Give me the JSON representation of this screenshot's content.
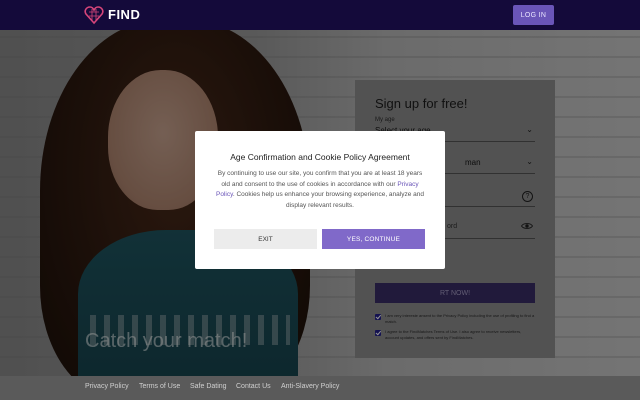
{
  "header": {
    "logo_text": "FIND",
    "logo_sub": "",
    "login_label": "LOG IN"
  },
  "hero": {
    "tagline": "Catch your match!"
  },
  "signup": {
    "title": "Sign up for free!",
    "age_label": "My age",
    "age_value": "Select your age",
    "iam_label": "I am",
    "iam_value": "man",
    "password_value": "ord",
    "start_label": "RT NOW!",
    "consent1": "I am very intereste ansent to the Privacy Policy including the use of profiling to find a match.",
    "consent2": "I agree to the FindMatches Terms of Use. I also agree to receive newsletters, account updates, and offers sent by FindMatches."
  },
  "modal": {
    "title": "Age Confirmation and Cookie Policy Agreement",
    "body_before": "By continuing to use our site, you confirm that you are at least 18 years old and consent to the use of cookies in accordance with our",
    "body_link": "Privacy Policy",
    "body_after": ". Cookies help us enhance your browsing experience, analyze and display relevant results.",
    "exit_label": "EXIT",
    "yes_label": "YES, CONTINUE"
  },
  "footer": {
    "links": [
      "Privacy Policy",
      "Terms of Use",
      "Safe Dating",
      "Contact Us",
      "Anti-Slavery Policy"
    ]
  },
  "colors": {
    "header_bg": "#140a3a",
    "accent": "#8069c9",
    "link": "#6a55b8",
    "logo_heart": "#d6457a"
  }
}
